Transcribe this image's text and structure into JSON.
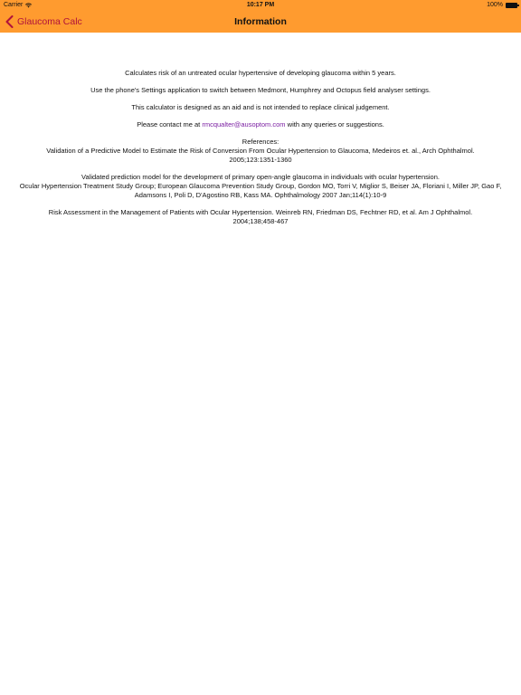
{
  "status": {
    "carrier": "Carrier",
    "time": "10:17 PM",
    "battery": "100%"
  },
  "nav": {
    "back_label": "Glaucoma Calc",
    "title": "Information"
  },
  "content": {
    "p1": "Calculates risk of an untreated ocular hypertensive of developing glaucoma within 5 years.",
    "p2": "Use the phone's Settings application to switch between Medmont, Humphrey and Octopus field analyser settings.",
    "p3": "This calculator is designed as an aid and is not intended to replace clinical judgement.",
    "contact_prefix": "Please contact me at ",
    "email": "rmcqualter@ausoptom.com",
    "contact_suffix": " with any queries or suggestions.",
    "references_heading": "References:",
    "ref1_line1": "Validation of a Predictive Model to Estimate the Risk of Conversion From Ocular Hypertension to Glaucoma, Medeiros et. al., Arch Ophthalmol.",
    "ref1_line2": "2005;123:1351-1360",
    "ref2_line1": "Validated prediction model for the development of primary open-angle glaucoma in individuals with ocular hypertension.",
    "ref2_line2": "Ocular Hypertension Treatment Study Group; European Glaucoma Prevention Study Group, Gordon MO, Torri V, Miglior S, Beiser JA, Floriani I, Miller JP, Gao F, Adamsons I, Poli D, D'Agostino RB, Kass MA. Ophthalmology 2007 Jan;114(1):10-9",
    "ref3_line1": "Risk Assessment in the Management of Patients with Ocular Hypertension. Weinreb RN, Friedman DS, Fechtner RD, et al. Am J Ophthalmol.",
    "ref3_line2": "2004;138;458-467"
  },
  "colors": {
    "header_bg": "#FF9B2F",
    "back_tint": "#B0123B",
    "link": "#7B1FA2"
  },
  "icons": {
    "back": "chevron-left-icon",
    "wifi": "wifi-icon",
    "battery": "battery-icon"
  }
}
